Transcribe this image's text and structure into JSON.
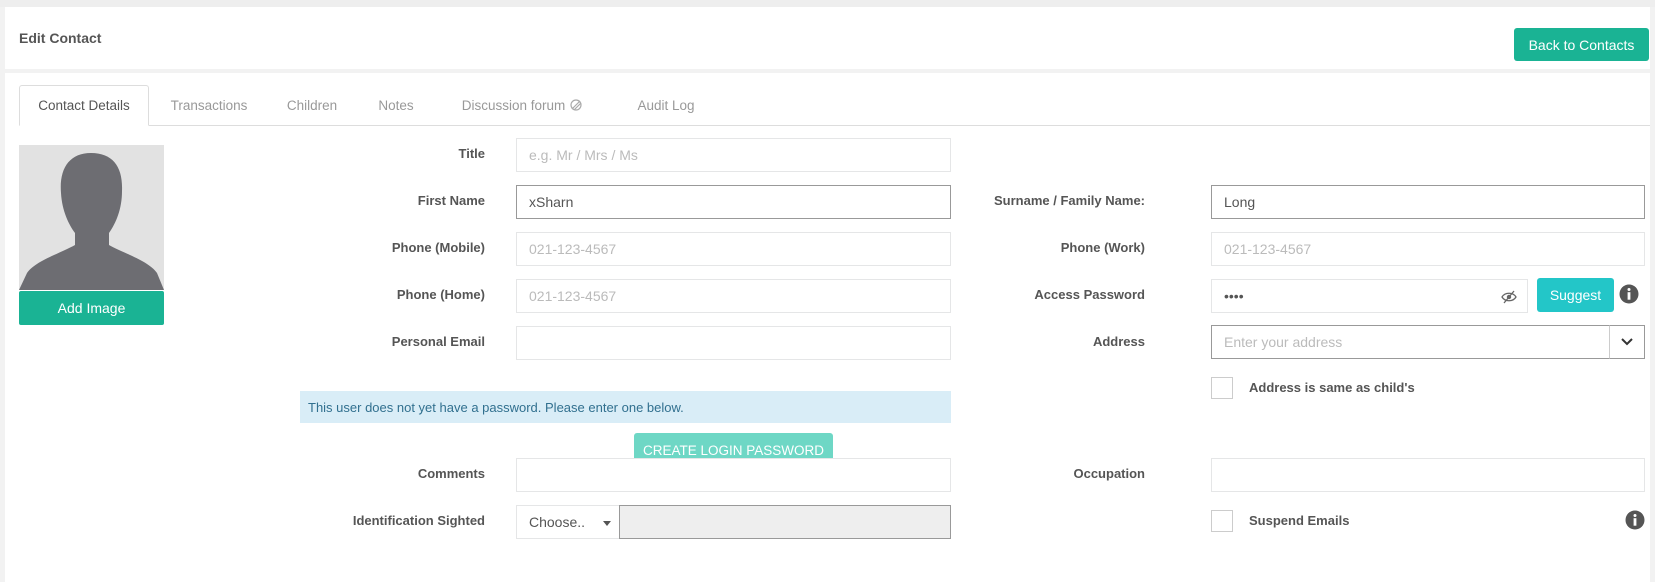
{
  "header": {
    "title": "Edit Contact",
    "back_label": "Back to Contacts"
  },
  "tabs": [
    {
      "label": "Contact Details"
    },
    {
      "label": "Transactions"
    },
    {
      "label": "Children"
    },
    {
      "label": "Notes"
    },
    {
      "label": "Discussion forum"
    },
    {
      "label": "Audit Log"
    }
  ],
  "avatar": {
    "add_image_label": "Add Image"
  },
  "form": {
    "title": {
      "label": "Title",
      "placeholder": "e.g. Mr / Mrs / Ms"
    },
    "first_name": {
      "label": "First Name",
      "value": "xSharn"
    },
    "surname": {
      "label": "Surname / Family Name:",
      "value": "Long"
    },
    "phone_mobile": {
      "label": "Phone (Mobile)",
      "placeholder": "021-123-4567"
    },
    "phone_work": {
      "label": "Phone (Work)",
      "placeholder": "021-123-4567"
    },
    "phone_home": {
      "label": "Phone (Home)",
      "placeholder": "021-123-4567"
    },
    "access_password": {
      "label": "Access Password",
      "value": "••••",
      "suggest_label": "Suggest"
    },
    "personal_email": {
      "label": "Personal Email",
      "value": ""
    },
    "address": {
      "label": "Address",
      "placeholder": "Enter your address"
    },
    "password_notice": "This user does not yet have a password. Please enter one below.",
    "address_same": {
      "label": "Address is same as child's"
    },
    "create_password_label": "CREATE LOGIN PASSWORD",
    "comments": {
      "label": "Comments",
      "value": ""
    },
    "occupation": {
      "label": "Occupation",
      "value": ""
    },
    "identification": {
      "label": "Identification Sighted",
      "selected": "Choose.."
    },
    "suspend_emails": {
      "label": "Suspend Emails"
    }
  },
  "colors": {
    "primary": "#1ab394",
    "info": "#23c6c8",
    "alert_bg": "#d9edf7",
    "alert_text": "#31708f"
  }
}
